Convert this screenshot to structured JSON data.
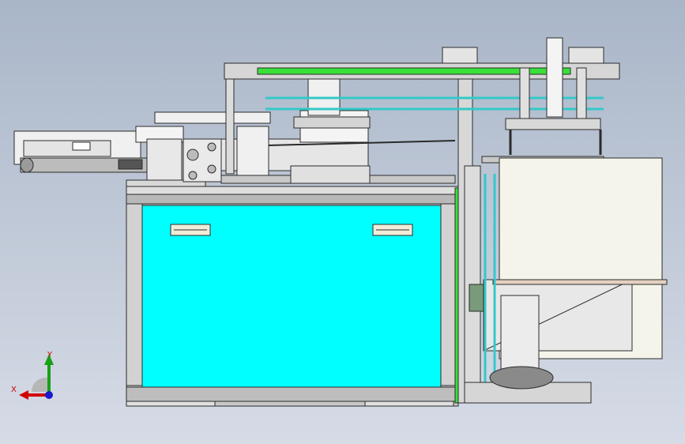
{
  "view": {
    "background_top": "#a9b6c8",
    "background_bottom": "#d6dbe6"
  },
  "triad": {
    "x_label": "X",
    "y_label": "Y",
    "x_color": "#d20000",
    "y_color": "#18a018",
    "z_color": "#1a1acc"
  },
  "colors": {
    "panel_fill": "#00ffff",
    "rail_green": "#39e039",
    "rod_cyan": "#34c8c8",
    "frame_gray": "#c4c4c4",
    "box_fill": "#f4f4ea"
  }
}
